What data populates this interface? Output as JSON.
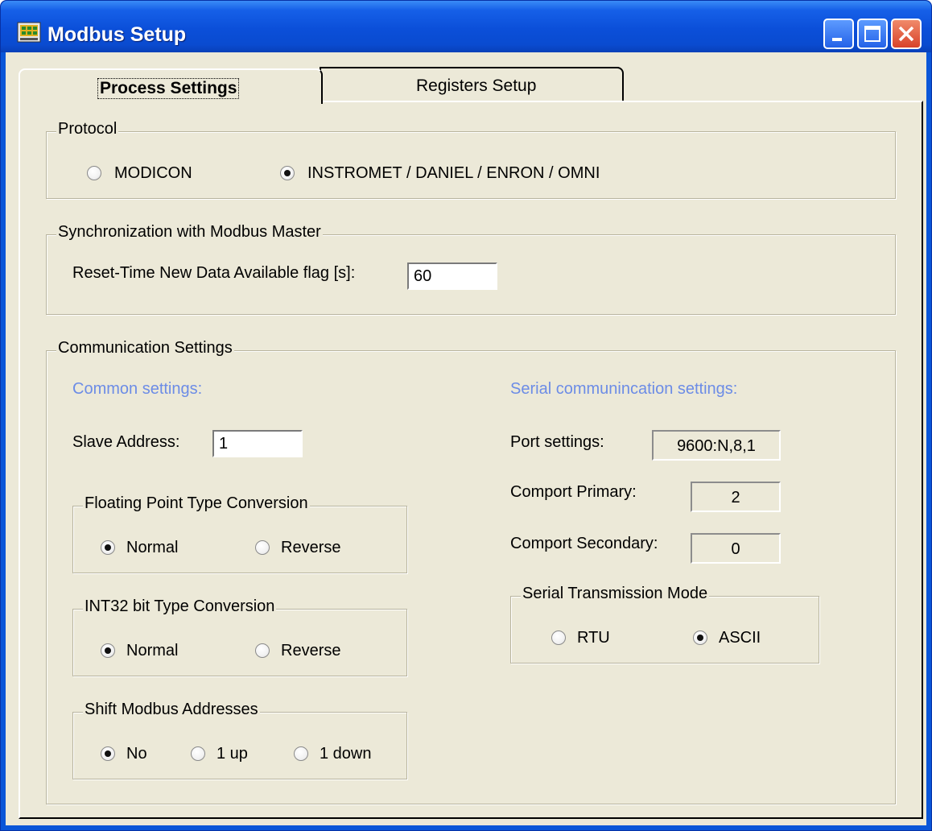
{
  "window": {
    "title": "Modbus Setup"
  },
  "tabs": [
    {
      "label": "Process Settings",
      "active": true
    },
    {
      "label": "Registers Setup",
      "active": false
    }
  ],
  "protocol": {
    "legend": "Protocol",
    "options": [
      {
        "label": "MODICON",
        "checked": false
      },
      {
        "label": "INSTROMET / DANIEL / ENRON / OMNI",
        "checked": true
      }
    ]
  },
  "sync": {
    "legend": "Synchronization with Modbus Master",
    "reset_label": "Reset-Time New Data Available flag [s]:",
    "reset_value": "60"
  },
  "comm": {
    "legend": "Communication Settings",
    "common_heading": "Common settings:",
    "serial_heading": "Serial communincation settings:",
    "slave_label": "Slave Address:",
    "slave_value": "1",
    "float_conv": {
      "legend": "Floating Point Type Conversion",
      "options": [
        {
          "label": "Normal",
          "checked": true
        },
        {
          "label": "Reverse",
          "checked": false
        }
      ]
    },
    "int32_conv": {
      "legend": "INT32 bit Type Conversion",
      "options": [
        {
          "label": "Normal",
          "checked": true
        },
        {
          "label": "Reverse",
          "checked": false
        }
      ]
    },
    "shift": {
      "legend": "Shift Modbus Addresses",
      "options": [
        {
          "label": "No",
          "checked": true
        },
        {
          "label": "1 up",
          "checked": false
        },
        {
          "label": "1 down",
          "checked": false
        }
      ]
    },
    "port_label": "Port settings:",
    "port_value": "9600:N,8,1",
    "comport_primary_label": "Comport Primary:",
    "comport_primary_value": "2",
    "comport_secondary_label": "Comport Secondary:",
    "comport_secondary_value": "0",
    "transmission": {
      "legend": "Serial Transmission Mode",
      "options": [
        {
          "label": "RTU",
          "checked": false
        },
        {
          "label": "ASCII",
          "checked": true
        }
      ]
    }
  }
}
